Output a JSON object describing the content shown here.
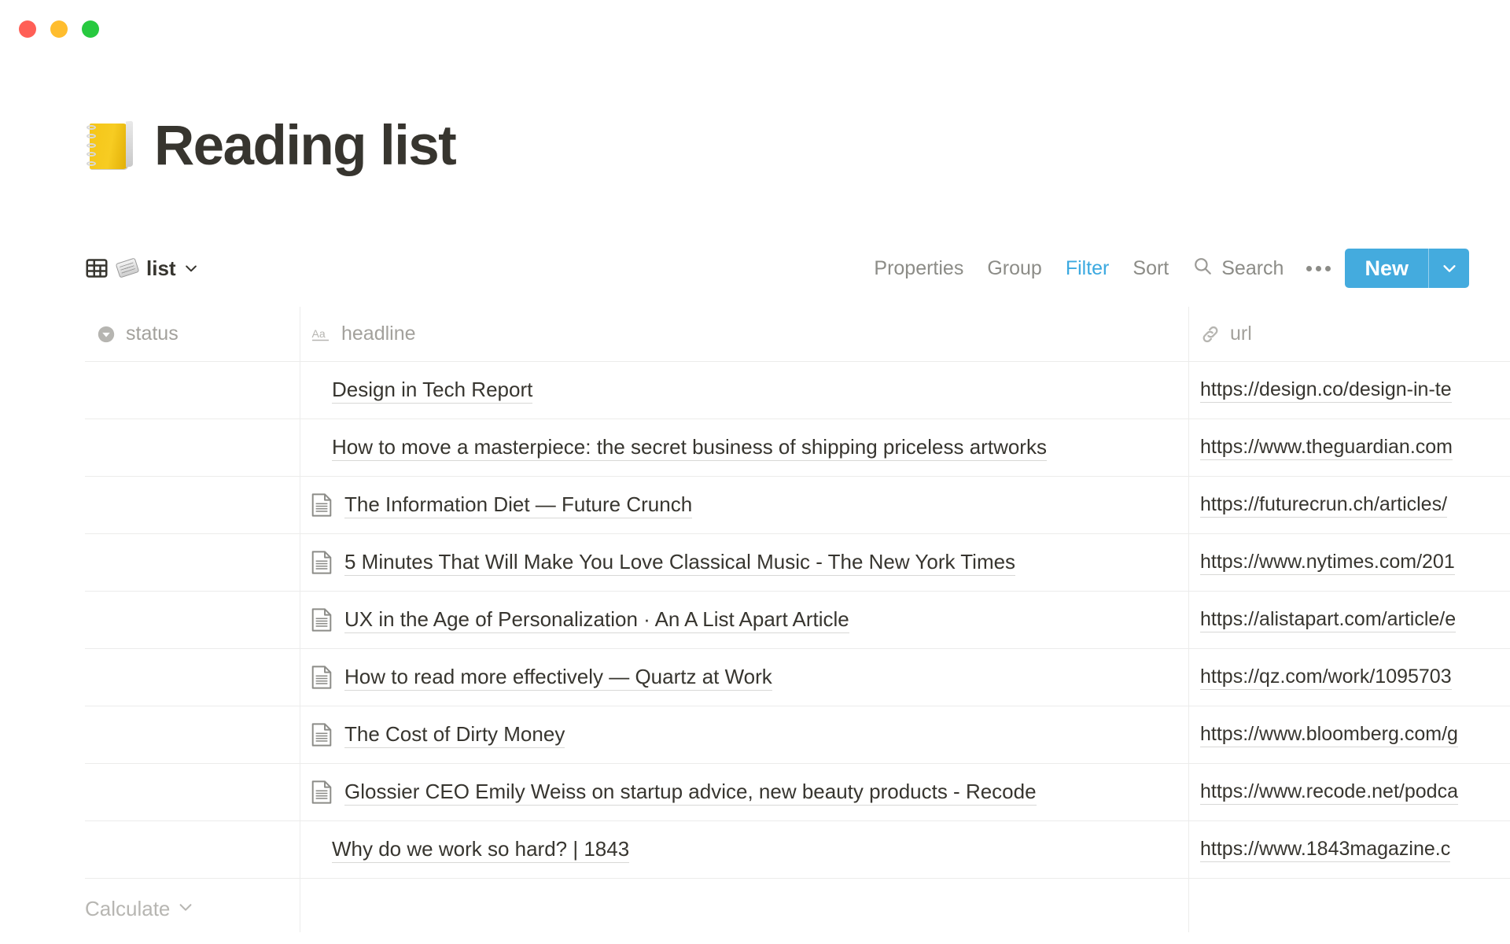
{
  "window": {
    "traffic_lights": [
      {
        "name": "close",
        "color": "#FF5F56"
      },
      {
        "name": "minimize",
        "color": "#FFBD2E"
      },
      {
        "name": "zoom",
        "color": "#27C93F"
      }
    ]
  },
  "page": {
    "emoji": "notebook-with-decorative-cover",
    "title": "Reading list"
  },
  "toolbar": {
    "view_icon": "table-grid-icon",
    "view_emoji": "rolled-up-newspaper",
    "view_name": "list",
    "view_caret": "chevron-down-icon",
    "properties_label": "Properties",
    "group_label": "Group",
    "filter_label": "Filter",
    "sort_label": "Sort",
    "search_label": "Search",
    "search_icon": "search-icon",
    "more_icon": "ellipsis-icon",
    "new_label": "New",
    "new_caret": "chevron-down-icon",
    "active_accent": "#3BA9E0",
    "new_button_color": "#44ABDE"
  },
  "table": {
    "columns": [
      {
        "key": "status",
        "label": "status",
        "icon": "select-property-icon"
      },
      {
        "key": "headline",
        "label": "headline",
        "icon": "title-text-property-icon"
      },
      {
        "key": "url",
        "label": "url",
        "icon": "link-property-icon"
      }
    ],
    "rows": [
      {
        "status": "",
        "has_page_icon": false,
        "headline": "Design in Tech Report",
        "url": "https://design.co/design-in-te"
      },
      {
        "status": "",
        "has_page_icon": false,
        "headline": "How to move a masterpiece: the secret business of shipping priceless artworks",
        "url": "https://www.theguardian.com"
      },
      {
        "status": "",
        "has_page_icon": true,
        "headline": "The Information Diet — Future Crunch",
        "url": "https://futurecrun.ch/articles/"
      },
      {
        "status": "",
        "has_page_icon": true,
        "headline": "5 Minutes That Will Make You Love Classical Music - The New York Times",
        "url": "https://www.nytimes.com/201"
      },
      {
        "status": "",
        "has_page_icon": true,
        "headline": "UX in the Age of Personalization · An A List Apart Article",
        "url": "https://alistapart.com/article/e"
      },
      {
        "status": "",
        "has_page_icon": true,
        "headline": "How to read more effectively — Quartz at Work",
        "url": "https://qz.com/work/1095703"
      },
      {
        "status": "",
        "has_page_icon": true,
        "headline": "The Cost of Dirty Money",
        "url": "https://www.bloomberg.com/g"
      },
      {
        "status": "",
        "has_page_icon": true,
        "headline": "Glossier CEO Emily Weiss on startup advice, new beauty products - Recode",
        "url": "https://www.recode.net/podca"
      },
      {
        "status": "",
        "has_page_icon": false,
        "headline": "Why do we work so hard? | 1843",
        "url": "https://www.1843magazine.c"
      }
    ]
  },
  "footer": {
    "calculate_label": "Calculate",
    "calculate_caret": "chevron-down-icon"
  }
}
